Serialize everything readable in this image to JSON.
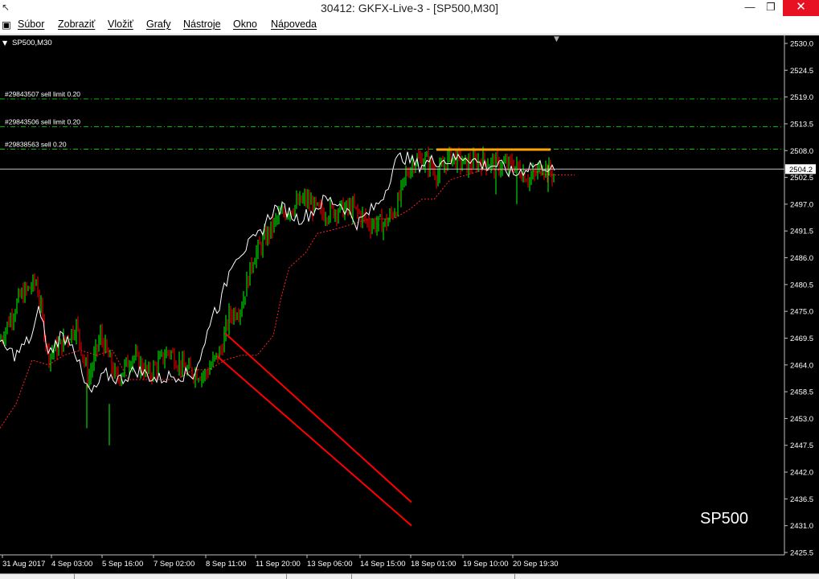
{
  "window": {
    "title": "30412: GKFX-Live-3 - [SP500,M30]",
    "min_glyph": "—",
    "max_glyph": "❐",
    "close_glyph": "✕"
  },
  "menu": [
    "Súbor",
    "Zobraziť",
    "Vložiť",
    "Grafy",
    "Nástroje",
    "Okno",
    "Nápoveda"
  ],
  "chart_label": "SP500,M30",
  "watermark": "SP500",
  "colors": {
    "background": "#000000",
    "bull_candle": "#00ff00",
    "bear_candle": "#ff0000",
    "compare_line": "#ffffff",
    "order_lines": "#00c000",
    "trend_lines": "#ff0000",
    "resistance": "#ffa500",
    "ma_dotted": "#ff2020",
    "price_line": "#c0c0c0"
  },
  "chart_data": {
    "type": "candlestick",
    "symbol": "SP500",
    "timeframe": "M30",
    "ylim": [
      2425.5,
      2531.5
    ],
    "y_ticks": [
      "2530.0",
      "2524.5",
      "2519.0",
      "2513.5",
      "2508.0",
      "2502.5",
      "2497.0",
      "2491.5",
      "2486.0",
      "2480.5",
      "2475.0",
      "2469.5",
      "2464.0",
      "2458.5",
      "2453.0",
      "2447.5",
      "2442.0",
      "2436.5",
      "2431.0",
      "2425.5"
    ],
    "x_ticks": [
      "31 Aug 2017",
      "4 Sep 03:00",
      "5 Sep 16:00",
      "7 Sep 02:00",
      "8 Sep 11:00",
      "11 Sep 20:00",
      "13 Sep 06:00",
      "14 Sep 15:00",
      "18 Sep 01:00",
      "19 Sep 10:00",
      "20 Sep 19:30"
    ],
    "current_price": "2504.2",
    "orders": [
      {
        "label": "#29843507 sell limit 0.20",
        "price": 2518.6
      },
      {
        "label": "#29843506 sell limit 0.20",
        "price": 2512.9
      },
      {
        "label": "#29838563 sell 0.20",
        "price": 2508.3
      }
    ],
    "resistance_price": 2508.2,
    "close_trend": [
      [
        0,
        2469
      ],
      [
        25,
        2478
      ],
      [
        45,
        2481
      ],
      [
        60,
        2466
      ],
      [
        75,
        2468
      ],
      [
        95,
        2472
      ],
      [
        110,
        2461
      ],
      [
        125,
        2470
      ],
      [
        145,
        2461
      ],
      [
        165,
        2466
      ],
      [
        185,
        2462
      ],
      [
        210,
        2467
      ],
      [
        230,
        2463
      ],
      [
        255,
        2462
      ],
      [
        275,
        2467
      ],
      [
        285,
        2474
      ],
      [
        300,
        2476
      ],
      [
        315,
        2486
      ],
      [
        330,
        2490
      ],
      [
        345,
        2494
      ],
      [
        360,
        2496
      ],
      [
        380,
        2498
      ],
      [
        400,
        2495
      ],
      [
        420,
        2496
      ],
      [
        440,
        2496
      ],
      [
        460,
        2493
      ],
      [
        480,
        2493
      ],
      [
        495,
        2497
      ],
      [
        505,
        2503
      ],
      [
        515,
        2506
      ],
      [
        530,
        2506
      ],
      [
        545,
        2503
      ],
      [
        560,
        2507
      ],
      [
        580,
        2505
      ],
      [
        600,
        2506
      ],
      [
        620,
        2505
      ],
      [
        640,
        2505
      ],
      [
        660,
        2502
      ],
      [
        675,
        2505
      ],
      [
        690,
        2503
      ]
    ],
    "ma_dotted": [
      [
        0,
        2451
      ],
      [
        20,
        2456
      ],
      [
        40,
        2465
      ],
      [
        60,
        2464
      ],
      [
        80,
        2466
      ],
      [
        100,
        2467
      ],
      [
        120,
        2466
      ],
      [
        140,
        2467
      ],
      [
        160,
        2461
      ],
      [
        180,
        2461
      ],
      [
        200,
        2461
      ],
      [
        220,
        2461
      ],
      [
        240,
        2463
      ],
      [
        260,
        2463
      ],
      [
        280,
        2465
      ],
      [
        300,
        2466
      ],
      [
        320,
        2466
      ],
      [
        340,
        2470
      ],
      [
        350,
        2478
      ],
      [
        360,
        2484
      ],
      [
        380,
        2487
      ],
      [
        395,
        2491
      ],
      [
        420,
        2492
      ],
      [
        440,
        2493
      ],
      [
        460,
        2494
      ],
      [
        490,
        2494
      ],
      [
        510,
        2496
      ],
      [
        525,
        2498
      ],
      [
        540,
        2498
      ],
      [
        560,
        2502
      ],
      [
        580,
        2503
      ],
      [
        600,
        2504
      ],
      [
        620,
        2504
      ],
      [
        640,
        2504
      ],
      [
        660,
        2504
      ],
      [
        680,
        2503
      ],
      [
        715,
        2503
      ]
    ],
    "compare_line": [
      [
        0,
        2468
      ],
      [
        20,
        2466
      ],
      [
        40,
        2470
      ],
      [
        50,
        2476
      ],
      [
        60,
        2466
      ],
      [
        75,
        2470
      ],
      [
        90,
        2469
      ],
      [
        105,
        2460
      ],
      [
        115,
        2458
      ],
      [
        130,
        2462
      ],
      [
        150,
        2461
      ],
      [
        170,
        2463
      ],
      [
        195,
        2461
      ],
      [
        220,
        2462
      ],
      [
        240,
        2462
      ],
      [
        255,
        2468
      ],
      [
        262,
        2474
      ],
      [
        275,
        2477
      ],
      [
        290,
        2486
      ],
      [
        305,
        2488
      ],
      [
        320,
        2490
      ],
      [
        340,
        2496
      ],
      [
        355,
        2496
      ],
      [
        370,
        2494
      ],
      [
        385,
        2495
      ],
      [
        405,
        2498
      ],
      [
        425,
        2497
      ],
      [
        445,
        2493
      ],
      [
        470,
        2497
      ],
      [
        480,
        2500
      ],
      [
        490,
        2505
      ],
      [
        500,
        2507
      ],
      [
        520,
        2505
      ],
      [
        540,
        2506
      ],
      [
        560,
        2506
      ],
      [
        580,
        2507
      ],
      [
        600,
        2505
      ],
      [
        620,
        2505
      ],
      [
        640,
        2503
      ],
      [
        660,
        2505
      ],
      [
        680,
        2505
      ],
      [
        692,
        2503
      ]
    ],
    "trend_lines": [
      {
        "from": [
          280,
          2470.5
        ],
        "to": [
          512,
          2435.8
        ]
      },
      {
        "from": [
          270,
          2465.8
        ],
        "to": [
          512,
          2431.0
        ]
      }
    ]
  }
}
